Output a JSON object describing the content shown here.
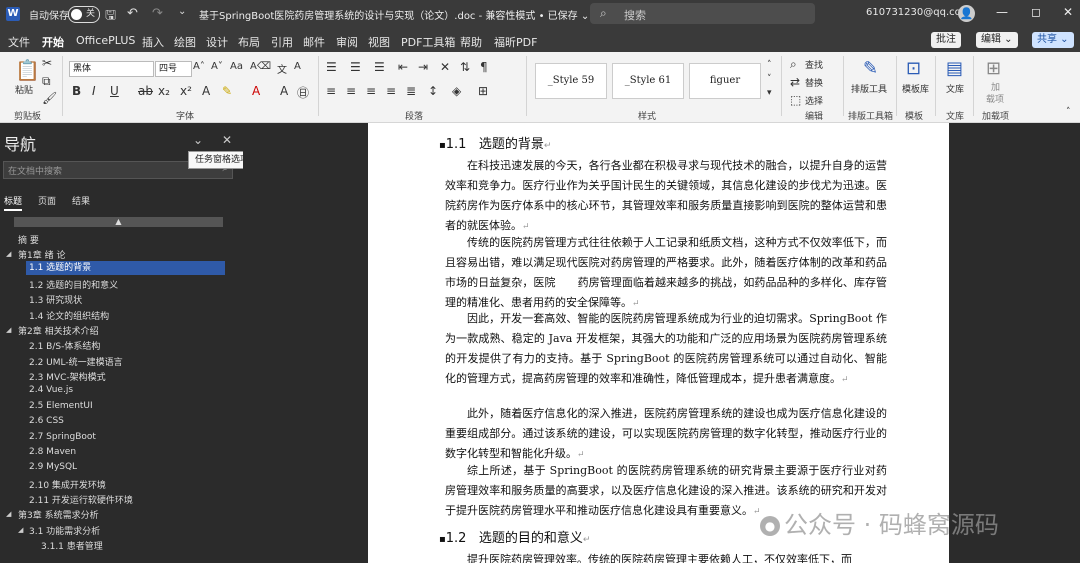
{
  "titlebar": {
    "autosave_label": "自动保存",
    "toggle_state": "关",
    "document_title": "基于SpringBoot医院药房管理系统的设计与实现（论文）.doc - 兼容性模式 • 已保存 ⌄",
    "search_placeholder": "搜索",
    "account": "610731230@qq.com"
  },
  "menu": {
    "items": [
      "文件",
      "开始",
      "OfficePLUS",
      "插入",
      "绘图",
      "设计",
      "布局",
      "引用",
      "邮件",
      "审阅",
      "视图",
      "PDF工具箱",
      "帮助",
      "福昕PDF"
    ],
    "active": "开始",
    "comment_btn": "批注",
    "edit_btn": "编辑 ⌄",
    "share_btn": "共享 ⌄"
  },
  "ribbon": {
    "paste_label": "粘贴",
    "clipboard_label": "剪贴板",
    "font_name": "黑体",
    "font_size": "四号",
    "font_group_label": "字体",
    "paragraph_group_label": "段落",
    "styles": [
      "_Style 59",
      "_Style 61",
      "figuer"
    ],
    "style_group_label": "样式",
    "find_label": "查找",
    "replace_label": "替换",
    "select_label": "选择",
    "edit_group_label": "编辑",
    "layout_tool_label": "排版工具",
    "layout_group_label": "排版工具箱",
    "template_label": "模板库",
    "template_group_label": "模板",
    "library_label": "文库",
    "library_group_label": "文库",
    "addin_label1": "加",
    "addin_label2": "载项",
    "addin_group_label": "加载项"
  },
  "nav": {
    "title": "导航",
    "search_placeholder": "在文档中搜索",
    "tooltip": "任务窗格选项",
    "tabs": [
      "标题",
      "页面",
      "结果"
    ],
    "collapse_glyph": "▲",
    "items": [
      "摘  要",
      "第1章 绪 论",
      "1.1 选题的背景",
      "1.2 选题的目的和意义",
      "1.3 研究现状",
      "1.4 论文的组织结构",
      "第2章 相关技术介绍",
      "2.1 B/S-体系结构",
      "2.2 UML-统一建模语言",
      "2.3 MVC-架构模式",
      "2.4 Vue.js",
      "2.5 ElementUI",
      "2.6 CSS",
      "2.7 SpringBoot",
      "2.8 Maven",
      "2.9 MySQL",
      "2.10 集成开发环境",
      "2.11 开发运行软硬件环境",
      "第3章 系统需求分析",
      "3.1 功能需求分析",
      "3.1.1 患者管理"
    ]
  },
  "doc": {
    "heading1_num": "1.1",
    "heading1": "选题的背景",
    "paragraphs": [
      "在科技迅速发展的今天，各行各业都在积极寻求与现代技术的融合，以提升自身的运营效率和竞争力。医疗行业作为关乎国计民生的关键领域，其信息化建设的步伐尤为迅速。医院药房作为医疗体系中的核心环节，其管理效率和服务质量直接影响到医院的整体运营和患者的就医体验。",
      "传统的医院药房管理方式往往依赖于人工记录和纸质文档，这种方式不仅效率低下，而且容易出错，难以满足现代医院对药房管理的严格要求。此外，随着医疗体制的改革和药品市场的日益复杂，医院　　药房管理面临着越来越多的挑战，如药品品种的多样化、库存管理的精准化、患者用药的安全保障等。",
      "因此，开发一套高效、智能的医院药房管理系统成为行业的迫切需求。SpringBoot 作为一款成熟、稳定的 Java 开发框架，其强大的功能和广泛的应用场景为医院药房管理系统的开发提供了有力的支持。基于 SpringBoot 的医院药房管理系统可以通过自动化、智能化的管理方式，提高药房管理的效率和准确性，降低管理成本，提升患者满意度。",
      "此外，随着医疗信息化的深入推进，医院药房管理系统的建设也成为医疗信息化建设的重要组成部分。通过该系统的建设，可以实现医院药房管理的数字化转型，推动医疗行业的数字化转型和智能化升级。",
      "综上所述，基于 SpringBoot 的医院药房管理系统的研究背景主要源于医疗行业对药房管理效率和服务质量的高要求，以及医疗信息化建设的深入推进。该系统的研究和开发对于提升医院药房管理水平和推动医疗信息化建设具有重要意义。"
    ],
    "heading2_num": "1.2",
    "heading2": "选题的目的和意义",
    "partial_line": "提升医院药房管理效率。传统的医院药房管理主要依赖人工，不仅效率低下，而"
  },
  "watermark": "公众号 · 码蜂窝源码"
}
